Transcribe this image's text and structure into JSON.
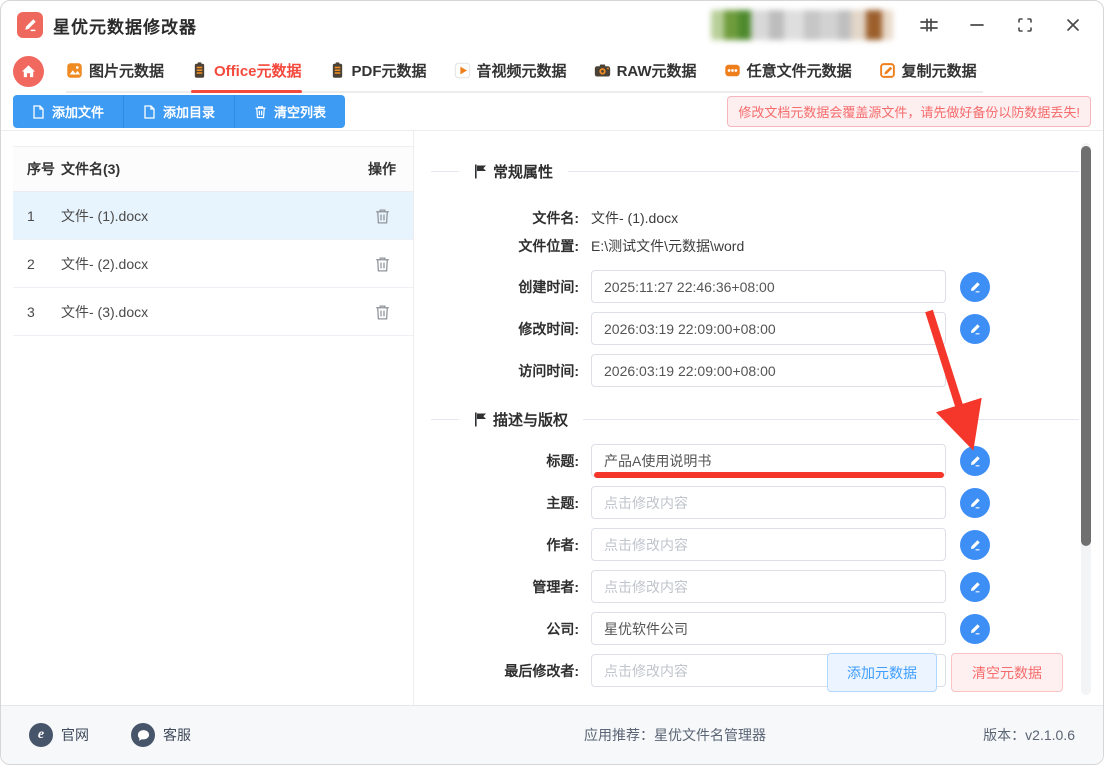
{
  "colors": {
    "primary_blue": "#3d9bf4",
    "edit_button_blue": "#3d8ff5",
    "active_tab_red": "#f4493d",
    "annotation_red": "#f5372b",
    "warning_red": "#f56c6c",
    "selected_row_blue": "#e8f4fd",
    "brand_salmon": "#ee685d"
  },
  "window": {
    "title": "星优元数据修改器"
  },
  "tabs": [
    {
      "label": "图片元数据"
    },
    {
      "label": "Office元数据"
    },
    {
      "label": "PDF元数据"
    },
    {
      "label": "音视频元数据"
    },
    {
      "label": "RAW元数据"
    },
    {
      "label": "任意文件元数据"
    },
    {
      "label": "复制元数据"
    }
  ],
  "toolbar": {
    "add_file": "添加文件",
    "add_dir": "添加目录",
    "clear_list": "清空列表",
    "warning": "修改文档元数据会覆盖源文件，请先做好备份以防数据丢失!"
  },
  "file_table": {
    "col_index": "序号",
    "col_name": "文件名(3)",
    "col_action": "操作",
    "rows": [
      {
        "index": "1",
        "name": "文件- (1).docx"
      },
      {
        "index": "2",
        "name": "文件- (2).docx"
      },
      {
        "index": "3",
        "name": "文件- (3).docx"
      }
    ]
  },
  "general": {
    "title": "常规属性",
    "file_name_label": "文件名:",
    "file_name": "文件- (1).docx",
    "location_label": "文件位置:",
    "location": "E:\\测试文件\\元数据\\word",
    "created_label": "创建时间:",
    "created": "2025:11:27 22:46:36+08:00",
    "modified_label": "修改时间:",
    "modified": "2026:03:19 22:09:00+08:00",
    "accessed_label": "访问时间:",
    "accessed": "2026:03:19 22:09:00+08:00"
  },
  "description": {
    "title": "描述与版权",
    "fields": [
      {
        "label": "标题:",
        "value": "产品A使用说明书"
      },
      {
        "label": "主题:",
        "placeholder": "点击修改内容"
      },
      {
        "label": "作者:",
        "placeholder": "点击修改内容"
      },
      {
        "label": "管理者:",
        "placeholder": "点击修改内容"
      },
      {
        "label": "公司:",
        "value": "星优软件公司"
      },
      {
        "label": "最后修改者:",
        "placeholder": "点击修改内容"
      }
    ]
  },
  "actions": {
    "add_metadata": "添加元数据",
    "clear_metadata": "清空元数据"
  },
  "footer": {
    "website": "官网",
    "support": "客服",
    "recommend": "应用推荐：星优文件名管理器",
    "version": "版本：v2.1.0.6"
  }
}
